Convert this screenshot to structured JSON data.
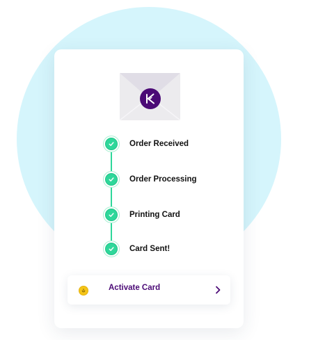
{
  "steps": [
    {
      "label": "Order Received",
      "status": "complete",
      "icon": "check-icon"
    },
    {
      "label": "Order Processing",
      "status": "complete",
      "icon": "check-icon"
    },
    {
      "label": "Printing Card",
      "status": "complete",
      "icon": "check-icon"
    },
    {
      "label": "Card Sent!",
      "status": "complete",
      "icon": "check-icon"
    }
  ],
  "action": {
    "label": "Activate Card",
    "leading_icon": "coin-icon",
    "trailing_icon": "chevron-right-icon"
  },
  "envelope": {
    "icon": "envelope-icon",
    "badge_icon": "brand-logo-icon"
  },
  "colors": {
    "background_circle": "#d5f5fc",
    "brand_purple": "#4b0a76",
    "step_green": "#2fd79a",
    "coin_yellow": "#f5c518",
    "envelope_gray": "#ecebee"
  }
}
